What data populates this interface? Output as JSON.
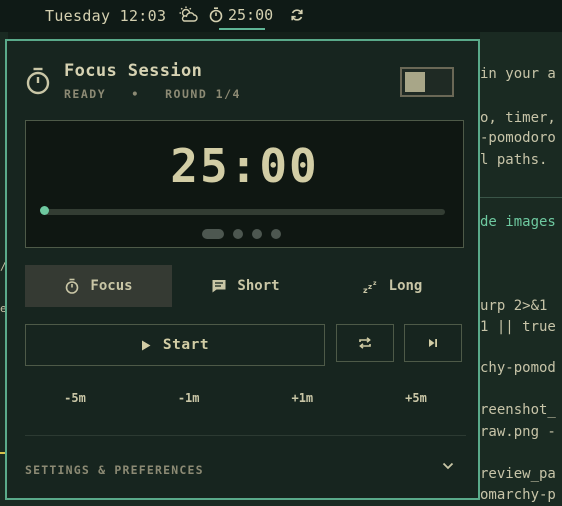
{
  "topbar": {
    "clock": "Tuesday 12:03",
    "weather_icon": "partly-cloudy-icon",
    "timer_icon": "stopwatch-icon",
    "timer_value": "25:00",
    "refresh_icon": "refresh-icon"
  },
  "terminal": {
    "lines": [
      "in your a",
      "o, timer,",
      "-pomodoro",
      "l paths.",
      "de images",
      "urp 2>&1",
      "1 || true",
      "chy-pomod",
      "reenshot_",
      "raw.png -",
      "review_pa",
      "omarchy-p"
    ]
  },
  "panel": {
    "title": "Focus Session",
    "status": "READY",
    "separator": "•",
    "round": "ROUND 1/4",
    "toggle_on": false,
    "display": {
      "time": "25:00",
      "progress": 0,
      "rounds_total": 4,
      "current_round": 1
    },
    "modes": [
      {
        "label": "Focus",
        "icon": "stopwatch-icon",
        "active": true
      },
      {
        "label": "Short",
        "icon": "chat-icon",
        "active": false
      },
      {
        "label": "Long",
        "icon": "sleep-zzz-icon",
        "active": false
      }
    ],
    "start_label": "Start",
    "start_icon": "play-icon",
    "reset_icon": "repeat-icon",
    "skip_icon": "skip-next-icon",
    "adjustments": [
      "-5m",
      "-1m",
      "+1m",
      "+5m"
    ],
    "settings_label": "SETTINGS & PREFERENCES"
  },
  "colors": {
    "accent": "#5fb596",
    "panel_bg": "#17251f",
    "text": "#c9c6a6"
  }
}
